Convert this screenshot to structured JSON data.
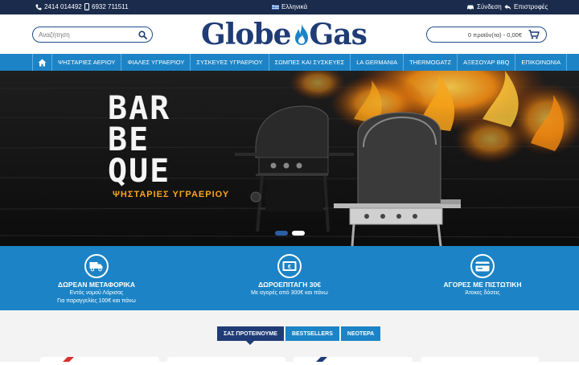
{
  "topbar": {
    "phone1": "2414 014492",
    "phone2": "6932 711511",
    "language": "Ελληνικά",
    "login": "Σύνδεση",
    "returns": "Επιστροφές"
  },
  "header": {
    "search_placeholder": "Αναζήτηση",
    "logo_left": "Globe",
    "logo_right": "Gas",
    "cart_text": "0 προϊόν(τα) - 0,00€"
  },
  "nav": {
    "items": [
      "ΨΗΣΤΑΡΙΕΣ ΑΕΡΙΟΥ",
      "ΦΙΑΛΕΣ ΥΓΡΑΕΡΙΟΥ",
      "ΣΥΣΚΕΥΕΣ ΥΓΡΑΕΡΙΟΥ",
      "ΣΩΜΠΕΣ ΚΑΙ ΣΥΣΚΕΥΕΣ",
      "LA GERMANIA",
      "THERMOGATZ",
      "ΑΞΕΣΟΥΑΡ BBQ",
      "ΕΠΙΚΟΙΝΩΝΙΑ"
    ]
  },
  "hero": {
    "line1": "BAR",
    "line2": "BE",
    "line3": "QUE",
    "subtitle": "ΨΗΣΤΑΡΙΕΣ ΥΓΡΑΕΡΙΟΥ",
    "slides": 2,
    "active_slide": 2
  },
  "features": [
    {
      "icon": "truck-icon",
      "title": "ΔΩΡΕΑΝ ΜΕΤΑΦΟΡΙΚΑ",
      "line1": "Εντός νομού Λάρισας",
      "line2": "Για παραγγελίες 100€ και πάνω"
    },
    {
      "icon": "money-icon",
      "title": "ΔΩΡΟΕΠΙΤΑΓΗ 30€",
      "line1": "Με αγορές από 300€ και πάνω",
      "line2": ""
    },
    {
      "icon": "credit-card-icon",
      "title": "ΑΓΟΡΕΣ ΜΕ ΠΙΣΤΩΤΙΚΗ",
      "line1": "Άτοκες δόσεις",
      "line2": ""
    }
  ],
  "tabs": [
    "ΣΑΣ ΠΡΟΤΕΙΝΟΥΜΕ",
    "BESTSELLERS",
    "ΝΕΟΤΕΡΑ"
  ],
  "colors": {
    "topbar": "#1a2b4c",
    "brand_blue": "#1c84c6",
    "logo_navy": "#1f3c76",
    "flame_orange": "#f7a51b"
  }
}
